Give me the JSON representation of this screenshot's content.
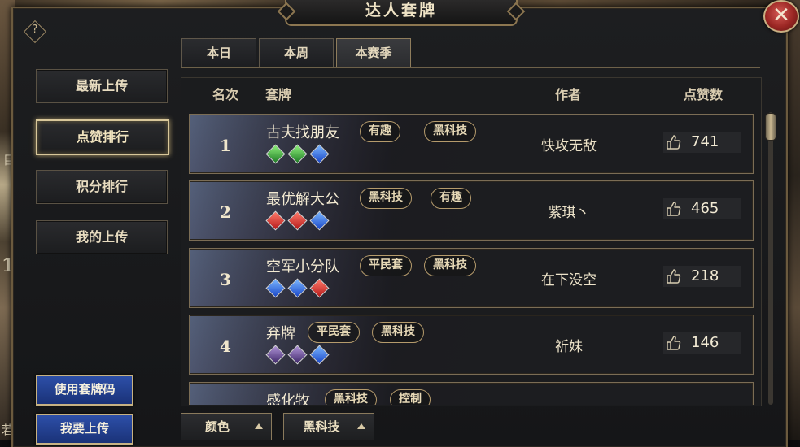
{
  "window": {
    "title": "达人套牌",
    "help_icon_text": "?",
    "close_icon_text": "✕"
  },
  "edge_fragments": [
    "目",
    "1",
    "若"
  ],
  "sidebar": {
    "items": [
      {
        "label": "最新上传",
        "active": false
      },
      {
        "label": "点赞排行",
        "active": true
      },
      {
        "label": "积分排行",
        "active": false
      },
      {
        "label": "我的上传",
        "active": false
      }
    ],
    "use_code_button": "使用套牌码",
    "upload_button": "我要上传"
  },
  "tabs": [
    {
      "label": "本日",
      "active": false
    },
    {
      "label": "本周",
      "active": false
    },
    {
      "label": "本赛季",
      "active": true
    }
  ],
  "table": {
    "headers": {
      "rank": "名次",
      "deck": "套牌",
      "author": "作者",
      "likes": "点赞数"
    },
    "rows": [
      {
        "rank": "1",
        "name": "古夫找朋友",
        "tags": [
          "有趣",
          "黑科技"
        ],
        "gems": [
          "green",
          "green",
          "blue"
        ],
        "author": "快攻无敌",
        "likes": "741"
      },
      {
        "rank": "2",
        "name": "最优解大公",
        "tags": [
          "黑科技",
          "有趣"
        ],
        "gems": [
          "red",
          "red",
          "blue"
        ],
        "author": "紫琪丶",
        "likes": "465"
      },
      {
        "rank": "3",
        "name": "空军小分队",
        "tags": [
          "平民套",
          "黑科技"
        ],
        "gems": [
          "blue",
          "blue",
          "red"
        ],
        "author": "在下没空",
        "likes": "218"
      },
      {
        "rank": "4",
        "name": "弃牌",
        "tags": [
          "平民套",
          "黑科技"
        ],
        "gems": [
          "purple",
          "purple",
          "blue"
        ],
        "author": "祈妹",
        "likes": "146"
      },
      {
        "rank": "",
        "name": "感化牧",
        "tags": [
          "黑科技",
          "控制"
        ],
        "gems": [],
        "author": "",
        "likes": ""
      }
    ]
  },
  "filters": [
    {
      "label": "颜色"
    },
    {
      "label": "黑科技"
    }
  ],
  "colors": {
    "accent_gold": "#c7b283",
    "blue_button": "#2d4fa8",
    "close_red": "#9a2623"
  }
}
